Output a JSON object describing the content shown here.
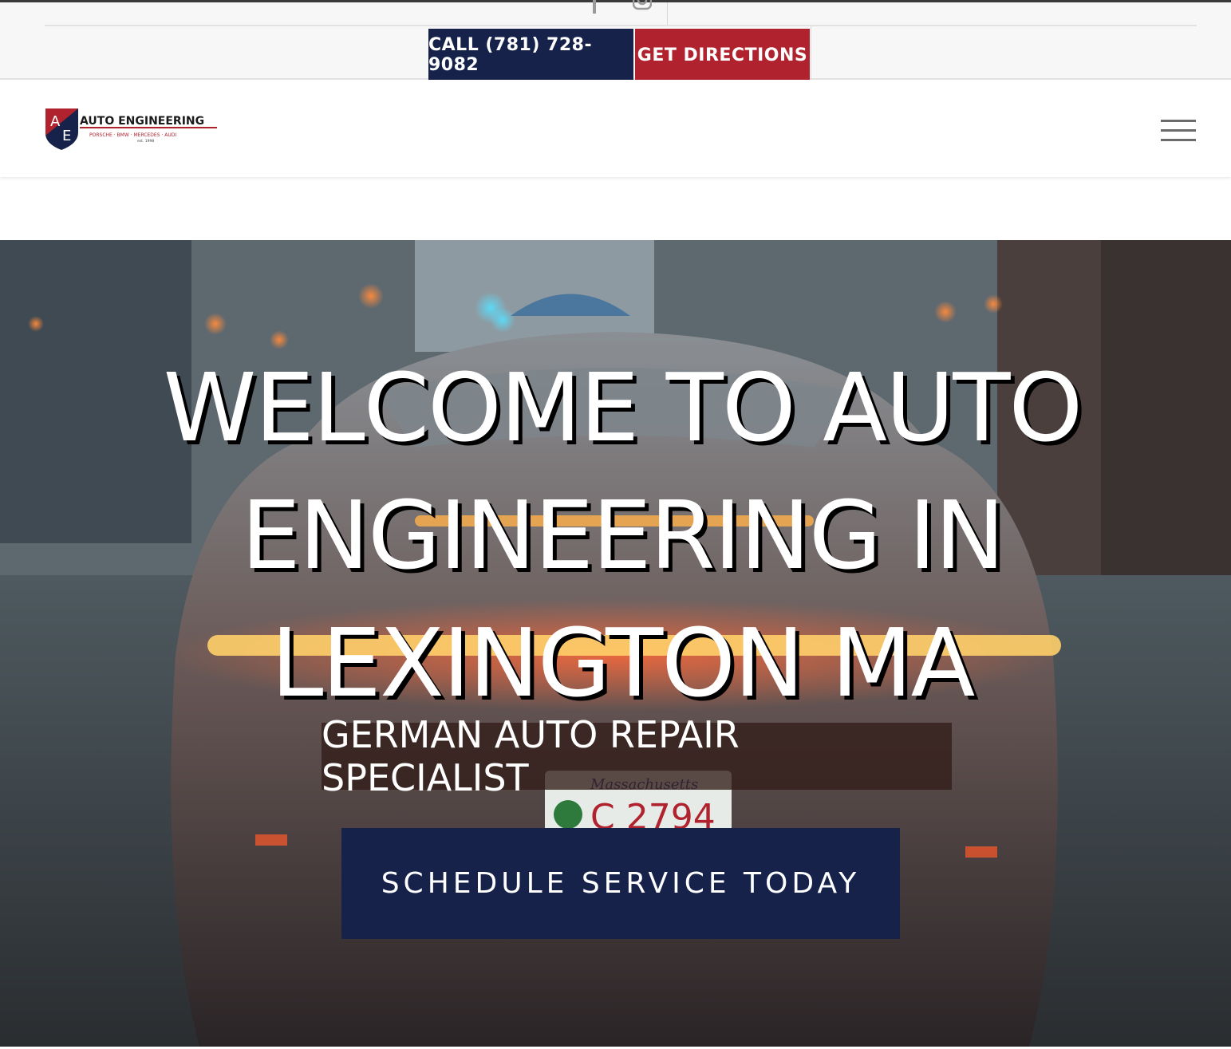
{
  "topbar": {
    "social": [
      "facebook-icon",
      "instagram-icon"
    ],
    "call_label": "CALL (781) 728-9082",
    "directions_label": "GET DIRECTIONS",
    "colors": {
      "call": "#17224a",
      "directions": "#b0232e"
    }
  },
  "header": {
    "logo": {
      "brand": "AUTO ENGINEERING",
      "tagline": "PORSCHE · BMW · MERCEDES · AUDI",
      "est": "est. 1998",
      "monogram": "AE"
    },
    "menu_icon": "hamburger-icon"
  },
  "hero": {
    "headline": "WELCOME TO AUTO ENGINEERING IN LEXINGTON MA",
    "subheading": "GERMAN AUTO REPAIR SPECIALIST",
    "cta_label": "SCHEDULE SERVICE TODAY"
  }
}
